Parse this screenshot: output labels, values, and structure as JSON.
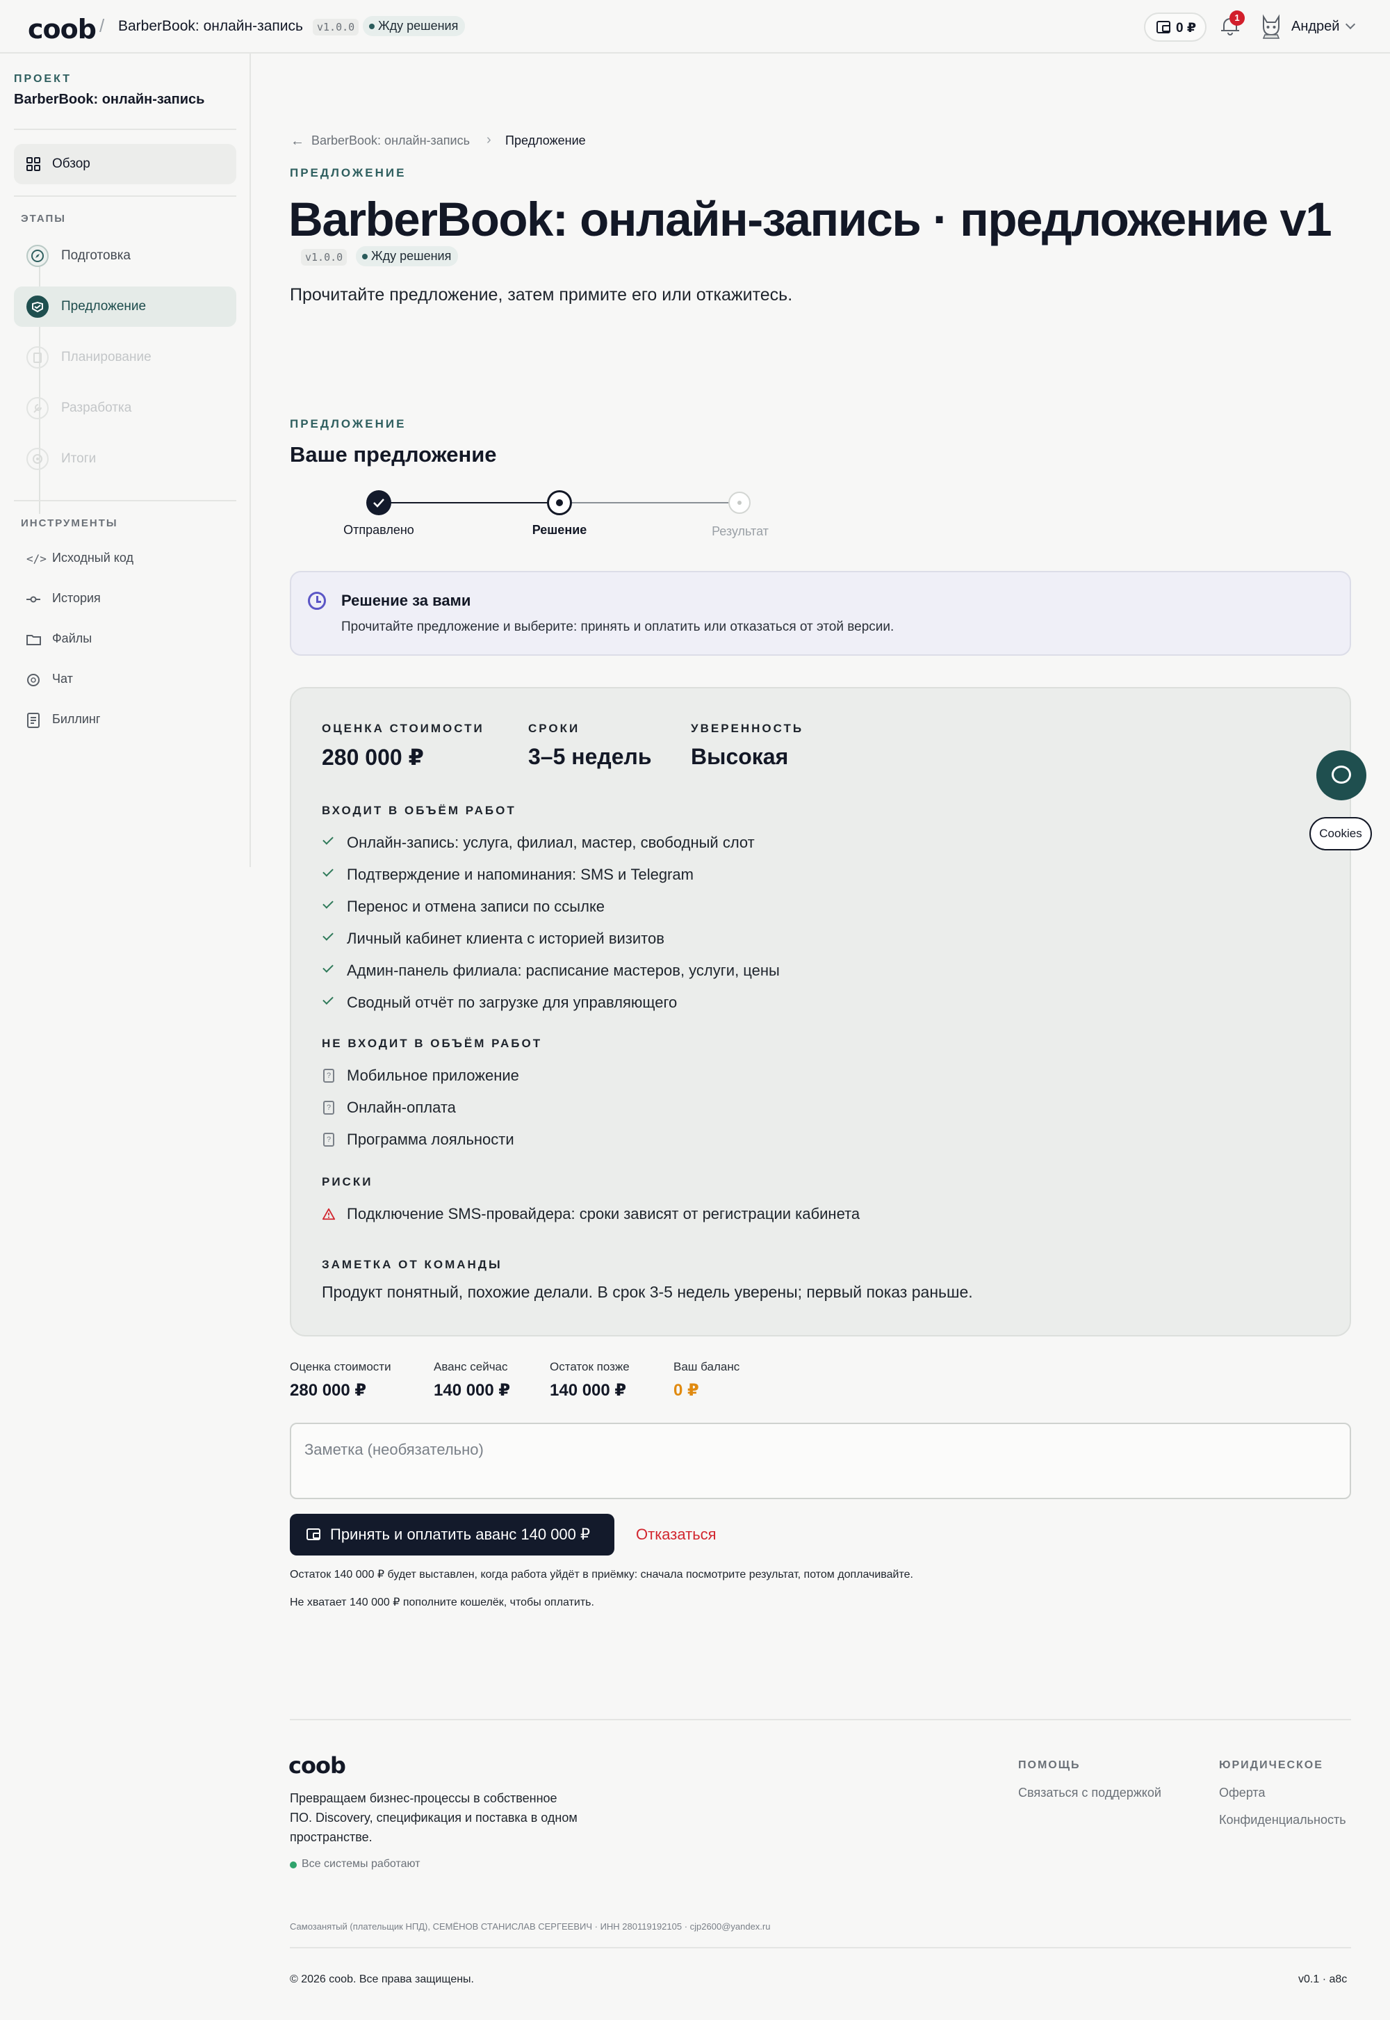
{
  "header": {
    "logo": "coob",
    "separator": "/",
    "project_title": "BarberBook: онлайн-запись",
    "version": "v1.0.0",
    "status": "Жду решения",
    "wallet_amount": "0 ₽",
    "notifications_count": "1",
    "user_name": "Андрей"
  },
  "sidebar": {
    "project_label": "ПРОЕКТ",
    "project_name": "BarberBook: онлайн-запись",
    "overview": "Обзор",
    "stages_label": "ЭТАПЫ",
    "stages": [
      {
        "label": "Подготовка",
        "state": "done"
      },
      {
        "label": "Предложение",
        "state": "active"
      },
      {
        "label": "Планирование",
        "state": "disabled"
      },
      {
        "label": "Разработка",
        "state": "disabled"
      },
      {
        "label": "Итоги",
        "state": "disabled"
      }
    ],
    "tools_label": "ИНСТРУМЕНТЫ",
    "tools": [
      {
        "label": "Исходный код",
        "icon": "code-icon"
      },
      {
        "label": "История",
        "icon": "commit-icon"
      },
      {
        "label": "Файлы",
        "icon": "folder-icon"
      },
      {
        "label": "Чат",
        "icon": "chat-icon"
      },
      {
        "label": "Биллинг",
        "icon": "receipt-icon"
      }
    ]
  },
  "breadcrumb": {
    "parent": "BarberBook: онлайн-запись",
    "current": "Предложение"
  },
  "page": {
    "kicker": "ПРЕДЛОЖЕНИЕ",
    "title": "BarberBook: онлайн-запись · предложение v1",
    "version": "v1.0.0",
    "status": "Жду решения",
    "lead": "Прочитайте предложение, затем примите его или откажитесь."
  },
  "proposal": {
    "kicker": "ПРЕДЛОЖЕНИЕ",
    "title": "Ваше предложение",
    "steps": [
      {
        "label": "Отправлено",
        "state": "done"
      },
      {
        "label": "Решение",
        "state": "current"
      },
      {
        "label": "Результат",
        "state": "pending"
      }
    ],
    "notice_title": "Решение за вами",
    "notice_text": "Прочитайте предложение и выберите: принять и оплатить или отказаться от этой версии.",
    "metrics": [
      {
        "label": "ОЦЕНКА СТОИМОСТИ",
        "value": "280 000 ₽"
      },
      {
        "label": "СРОКИ",
        "value": "3–5 недель"
      },
      {
        "label": "УВЕРЕННОСТЬ",
        "value": "Высокая"
      }
    ],
    "in_scope_label": "ВХОДИТ В ОБЪЁМ РАБОТ",
    "in_scope": [
      "Онлайн-запись: услуга, филиал, мастер, свободный слот",
      "Подтверждение и напоминания: SMS и Telegram",
      "Перенос и отмена записи по ссылке",
      "Личный кабинет клиента с историей визитов",
      "Админ-панель филиала: расписание мастеров, услуги, цены",
      "Сводный отчёт по загрузке для управляющего"
    ],
    "out_scope_label": "НЕ ВХОДИТ В ОБЪЁМ РАБОТ",
    "out_scope": [
      "Мобильное приложение",
      "Онлайн-оплата",
      "Программа лояльности"
    ],
    "risks_label": "РИСКИ",
    "risks": [
      "Подключение SMS-провайдера: сроки зависят от регистрации кабинета"
    ],
    "team_note_label": "ЗАМЕТКА ОТ КОМАНДЫ",
    "team_note": "Продукт понятный, похожие делали. В срок 3-5 недель уверены; первый показ раньше."
  },
  "payment": {
    "items": [
      {
        "label": "Оценка стоимости",
        "value": "280 000 ₽"
      },
      {
        "label": "Аванс сейчас",
        "value": "140 000 ₽"
      },
      {
        "label": "Остаток позже",
        "value": "140 000 ₽"
      },
      {
        "label": "Ваш баланс",
        "value": "0 ₽"
      }
    ],
    "balance_color": "#e08a10",
    "note_placeholder": "Заметка (необязательно)",
    "accept_label": "Принять и оплатить аванс 140 000 ₽",
    "decline_label": "Отказаться",
    "hint1": "Остаток 140 000 ₽ будет выставлен, когда работа уйдёт в приёмку: сначала посмотрите результат, потом доплачивайте.",
    "hint2": "Не хватает 140 000 ₽ пополните кошелёк, чтобы оплатить."
  },
  "footer": {
    "logo": "coob",
    "tagline": "Превращаем бизнес-процессы в собственное ПО. Discovery, спецификация и поставка в одном пространстве.",
    "status": "Все системы работают",
    "help_label": "ПОМОЩЬ",
    "help_links": [
      "Связаться с поддержкой"
    ],
    "legal_label": "ЮРИДИЧЕСКОЕ",
    "legal_links": [
      "Оферта",
      "Конфиденциальность"
    ],
    "legal_text": "Самозанятый (плательщик НПД), СЕМЁНОВ СТАНИСЛАВ СЕРГЕЕВИЧ · ИНН 280119192105 · cjp2600@yandex.ru",
    "copyright": "© 2026 coob. Все права защищены.",
    "version": "v0.1 · a8c"
  },
  "widgets": {
    "cookies": "Cookies"
  },
  "colors": {
    "accent": "#1f4f4f",
    "primary_button": "#131a2b",
    "danger": "#d21f2b",
    "success": "#2f7a5a"
  }
}
